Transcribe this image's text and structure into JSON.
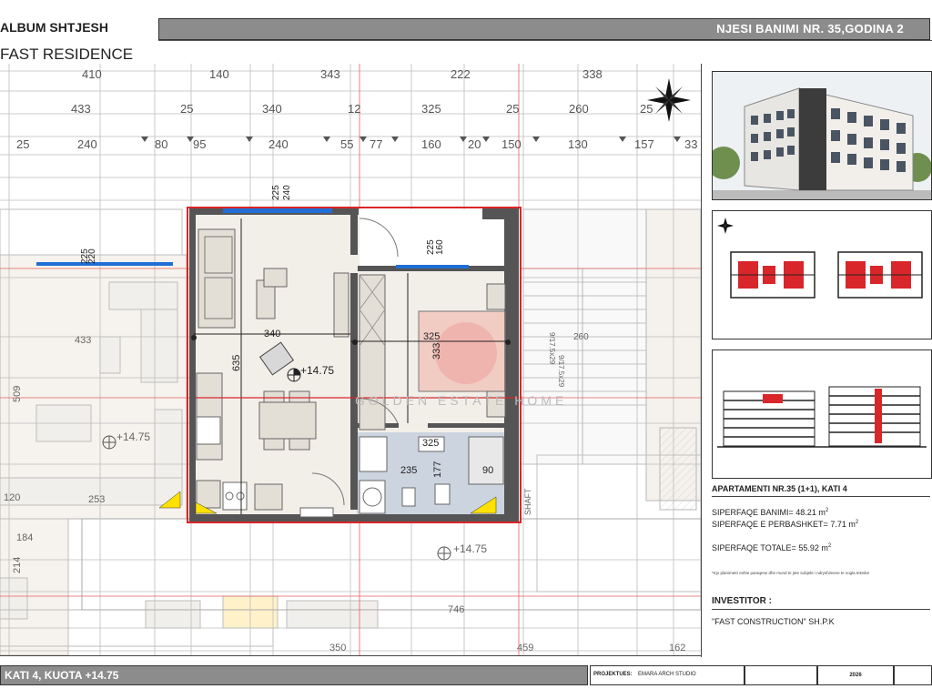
{
  "header": {
    "title": "ALBUM SHTJESH",
    "subtitle": "FAST RESIDENCE",
    "unit_title": "NJESI BANIMI NR. 35,GODINA 2"
  },
  "dims": {
    "row1": [
      "410",
      "140",
      "343",
      "222",
      "338"
    ],
    "row2": [
      "433",
      "25",
      "340",
      "12",
      "325",
      "25",
      "260",
      "25"
    ],
    "row3": [
      "25",
      "240",
      "80",
      "95",
      "240",
      "55",
      "77",
      "160",
      "20",
      "150",
      "130",
      "157",
      "33"
    ]
  },
  "plan": {
    "dim_top_a": "240",
    "dim_top_b": "225",
    "dim_balcony_a": "160",
    "dim_balcony_b": "225",
    "dim_left_a": "220",
    "dim_left_b": "225",
    "dim_living_w": "340",
    "dim_living_h": "635",
    "dim_bed_w": "325",
    "dim_bed_h": "333",
    "dim_bath_a": "325",
    "dim_bath_b": "235",
    "dim_bath_c": "177",
    "dim_bath_d": "90",
    "elev_unit": "+14.75",
    "elev_left": "+14.75",
    "elev_corridor": "+14.75",
    "dim_left_433": "433",
    "dim_left_509": "509",
    "dim_left_120": "120",
    "dim_left_253": "253",
    "dim_left_184": "184",
    "dim_left_214": "214",
    "dim_bottom_746": "746",
    "dim_bottom_350": "350",
    "dim_bottom_459": "459",
    "dim_bottom_162": "162",
    "shaft": "SHAFT",
    "stair_a": "9/17.5x29",
    "stair_b": "9/17.5x29",
    "stair_260": "260",
    "watermark": "GOLDEN ESTATE HOME"
  },
  "apartment": {
    "title": "APARTAMENTI NR.35 (1+1), KATI 4",
    "residential_label": "SIPERFAQE BANIMI=",
    "residential_value": "48.21 m",
    "common_label": "SIPERFAQE E PERBASHKET=",
    "common_value": "7.71 m",
    "total_label": "SIPERFAQE TOTALE=",
    "total_value": "55.92 m",
    "unit_sup": "2",
    "note": "*Kjo planimetri eshte paraqese dhe mund te jete subjekt i ndryshimeve te vogla teknike"
  },
  "investor": {
    "label": "INVESTITOR :",
    "name": "\"FAST CONSTRUCTION\" SH.P.K"
  },
  "footer": {
    "floor": "KATI 4, KUOTA +14.75",
    "project_label": "PROJEKTUES:",
    "project_value": "EMARA ARCH STUDIO",
    "year": "2026"
  },
  "colors": {
    "red": "#d9262a",
    "grid": "#b9b9b9",
    "bar": "#8c8c8c",
    "window": "#1f6fd6",
    "yellow": "#ffe100",
    "tile": "#c9d1de",
    "floor_fill": "#f1ede6",
    "salmon": "#f0b0a4"
  }
}
